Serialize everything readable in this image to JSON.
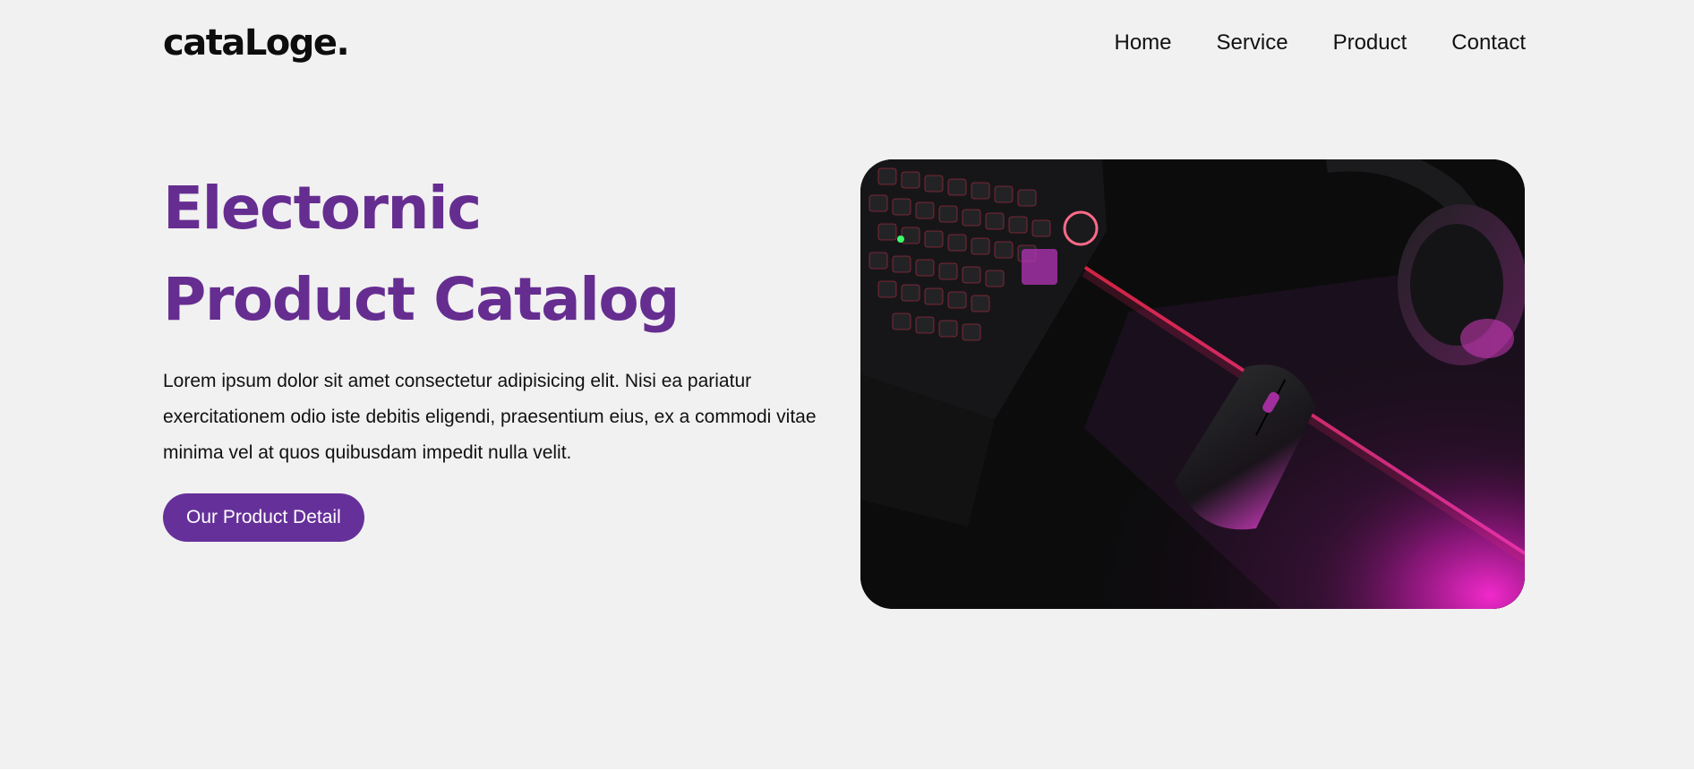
{
  "header": {
    "logo": "cataLoge.",
    "nav": [
      "Home",
      "Service",
      "Product",
      "Contact"
    ]
  },
  "hero": {
    "title_line1": "Electornic",
    "title_line2": "Product Catalog",
    "description": "Lorem ipsum dolor sit amet consectetur adipisicing elit. Nisi ea pariatur exercitationem odio iste debitis eligendi, praesentium eius, ex a commodi vitae minima vel at quos quibusdam impedit nulla velit.",
    "cta_label": "Our Product Detail",
    "image_alt": "gaming keyboard, mouse and headset on a desk"
  },
  "colors": {
    "background": "#f1f1f1",
    "accent": "#662d91",
    "button": "#66309a",
    "text": "#111111"
  }
}
